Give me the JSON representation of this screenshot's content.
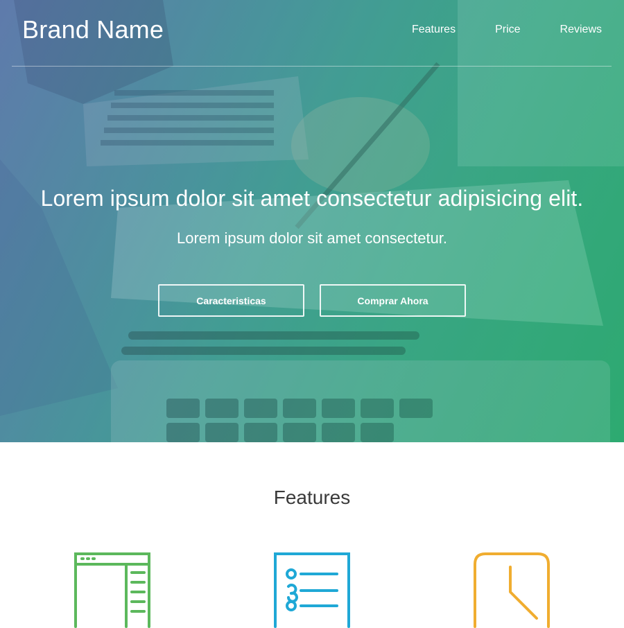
{
  "navbar": {
    "brand": "Brand Name",
    "links": [
      "Features",
      "Price",
      "Reviews"
    ]
  },
  "hero": {
    "title": "Lorem ipsum dolor sit amet consectetur adipisicing elit.",
    "subtitle": "Lorem ipsum dolor sit amet consectetur.",
    "buttons": [
      "Caracteristicas",
      "Comprar Ahora"
    ]
  },
  "features": {
    "title": "Features",
    "icons": [
      {
        "name": "browser-layout-icon",
        "color": "#5cb85c"
      },
      {
        "name": "checklist-icon",
        "color": "#1fa8d6"
      },
      {
        "name": "clock-icon",
        "color": "#f0ad30"
      }
    ]
  }
}
